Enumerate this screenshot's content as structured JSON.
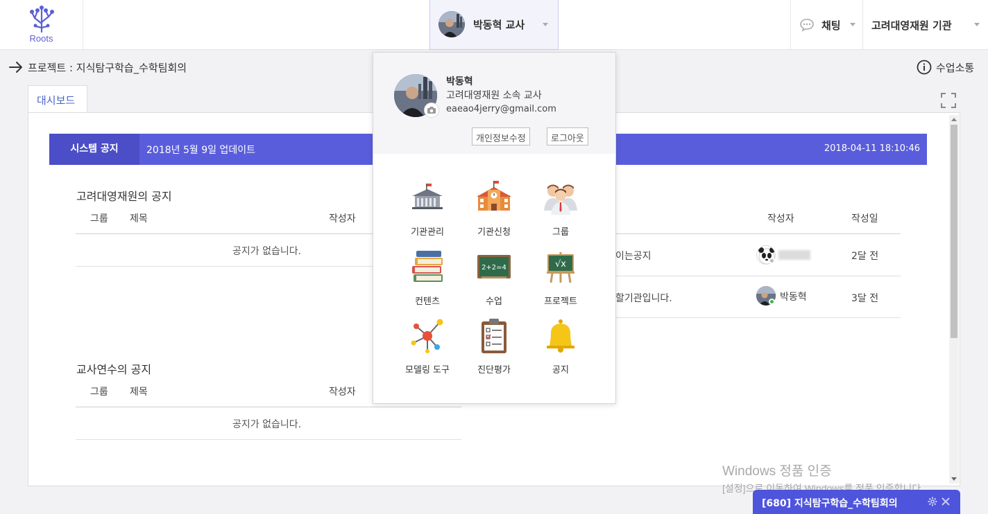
{
  "topbar": {
    "logo_text": "Roots",
    "user_label": "박동혁 교사",
    "chat_label": "채팅",
    "org_label": "고려대영재원 기관"
  },
  "breadcrumb": {
    "text": "프로젝트 : 지식탐구학습_수학팀회의",
    "right_label": "수업소통"
  },
  "tabs": [
    "대시보드"
  ],
  "system_notice": {
    "label": "시스템 공지",
    "message": "2018년 5월 9일 업데이트",
    "timestamp": "2018-04-11 18:10:46"
  },
  "sections": [
    {
      "title": "고려대영재원의 공지",
      "headers": [
        "그룹",
        "제목",
        "작성자"
      ],
      "empty_text": "공지가 없습니다."
    },
    {
      "title": "교사연수의 공지",
      "headers": [
        "그룹",
        "제목",
        "작성자"
      ],
      "empty_text": "공지가 없습니다."
    }
  ],
  "right_table": {
    "headers": [
      "작성자",
      "작성일"
    ],
    "rows": [
      {
        "title_fragment": "이는공지",
        "author": "",
        "date": "2달 전"
      },
      {
        "title_fragment": "할기관입니다.",
        "author": "박동혁",
        "date": "3달 전"
      }
    ]
  },
  "profile_dropdown": {
    "name": "박동혁",
    "role": "고려대영재원 소속 교사",
    "email": "eaeao4jerry@gmail.com",
    "edit_label": "개인정보수정",
    "logout_label": "로그아웃",
    "menu": [
      {
        "label": "기관관리",
        "icon": "institution-building-icon"
      },
      {
        "label": "기관신청",
        "icon": "school-building-icon"
      },
      {
        "label": "그룹",
        "icon": "group-people-icon"
      },
      {
        "label": "컨텐츠",
        "icon": "books-stack-icon"
      },
      {
        "label": "수업",
        "icon": "chalkboard-icon"
      },
      {
        "label": "프로젝트",
        "icon": "math-easel-icon"
      },
      {
        "label": "모델링 도구",
        "icon": "molecule-network-icon"
      },
      {
        "label": "진단평가",
        "icon": "clipboard-checklist-icon"
      },
      {
        "label": "공지",
        "icon": "bell-icon"
      }
    ]
  },
  "watermark": {
    "line1": "Windows 정품 인증",
    "line2": "[설정]으로 이동하여 Windows를 정품 인증합니다."
  },
  "chat_window": {
    "title": "[680] 지식탐구학습_수학팀회의"
  },
  "colors": {
    "accent": "#5a5ddb",
    "accent_dark": "#4b4ec7",
    "chat_bar": "#4e54dc",
    "online": "#3cb54a"
  }
}
